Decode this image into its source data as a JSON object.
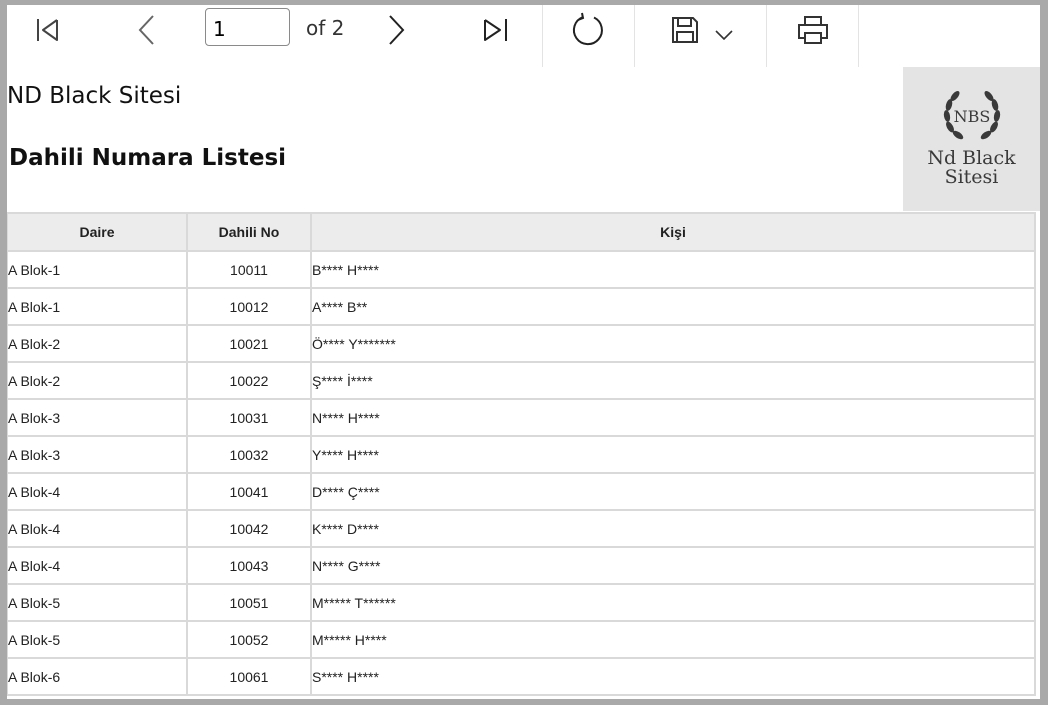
{
  "toolbar": {
    "page_current": "1",
    "page_of": "of 2",
    "icons": [
      "first-page-icon",
      "previous-page-icon",
      "next-page-icon",
      "last-page-icon",
      "refresh-icon",
      "save-icon",
      "chevron-down-icon",
      "print-icon"
    ]
  },
  "report": {
    "site_name": "ND Black Sitesi",
    "title": "Dahili Numara Listesi"
  },
  "logo": {
    "monogram": "NBS",
    "line1": "Nd Black",
    "line2": "Sitesi"
  },
  "table": {
    "headers": [
      "Daire",
      "Dahili No",
      "Kişi"
    ],
    "rows": [
      [
        "A Blok-1",
        "10011",
        "B**** H****"
      ],
      [
        "A Blok-1",
        "10012",
        "A**** B**"
      ],
      [
        "A Blok-2",
        "10021",
        "Ö**** Y*******"
      ],
      [
        "A Blok-2",
        "10022",
        "Ş**** İ****"
      ],
      [
        "A Blok-3",
        "10031",
        "N**** H****"
      ],
      [
        "A Blok-3",
        "10032",
        "Y**** H****"
      ],
      [
        "A Blok-4",
        "10041",
        "D**** Ç****"
      ],
      [
        "A Blok-4",
        "10042",
        "K**** D****"
      ],
      [
        "A Blok-4",
        "10043",
        "N**** G****"
      ],
      [
        "A Blok-5",
        "10051",
        "M***** T******"
      ],
      [
        "A Blok-5",
        "10052",
        "M***** H****"
      ],
      [
        "A Blok-6",
        "10061",
        "S**** H****"
      ]
    ]
  }
}
